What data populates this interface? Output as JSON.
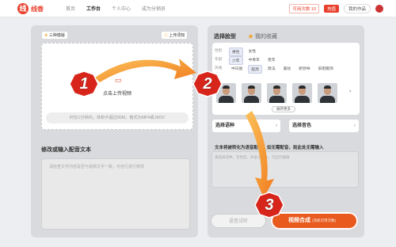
{
  "header": {
    "logo_mark": "线",
    "logo_text": "线香",
    "nav": [
      "首页",
      "工作台",
      "个人中心",
      "成为分销员"
    ],
    "balance": "可用次数 10",
    "recharge": "充值",
    "my_works": "我的作品"
  },
  "left": {
    "badge_left": "三种模版",
    "badge_right": "上传须知",
    "upload_label": "点击上传视频",
    "upload_hint": "时长1分钟内，体积不超过80M，格式为MP4或.MOV",
    "text_title": "修改或输入配音文本",
    "text_placeholder": "请检查文字内容是否与视频文字一致，可自行进行修改"
  },
  "right": {
    "tab_model": "选择脸型",
    "tab_favorites": "我的收藏",
    "filters": [
      {
        "label": "性别",
        "options": [
          "男性",
          "女性"
        ],
        "selected": "男性"
      },
      {
        "label": "年龄",
        "options": [
          "少年",
          "中青年",
          "老年"
        ],
        "selected": "少年"
      },
      {
        "label": "风格",
        "options": [
          "中日屋",
          "超高",
          "政法",
          "美妆",
          "新领导",
          "旧街服饰"
        ],
        "selected": "超高"
      }
    ],
    "collapse_label": "展开更多",
    "select_voice_type": "选择语种",
    "select_timbre": "选择音色",
    "voice_notice": "文本将被转化为语音配音，如无需配音，则此处无需输入",
    "voice_placeholder": "请选择语种，音色后，并录入文本，可自行编辑",
    "listen_button": "语音试听",
    "compose_button": "视频合成",
    "compose_sub": "(消耗可用次数)"
  },
  "step_numbers": [
    "1",
    "2",
    "3"
  ],
  "colors": {
    "accent": "#e8402c",
    "arrow": "#f29a38",
    "badge": "#d8251b"
  }
}
